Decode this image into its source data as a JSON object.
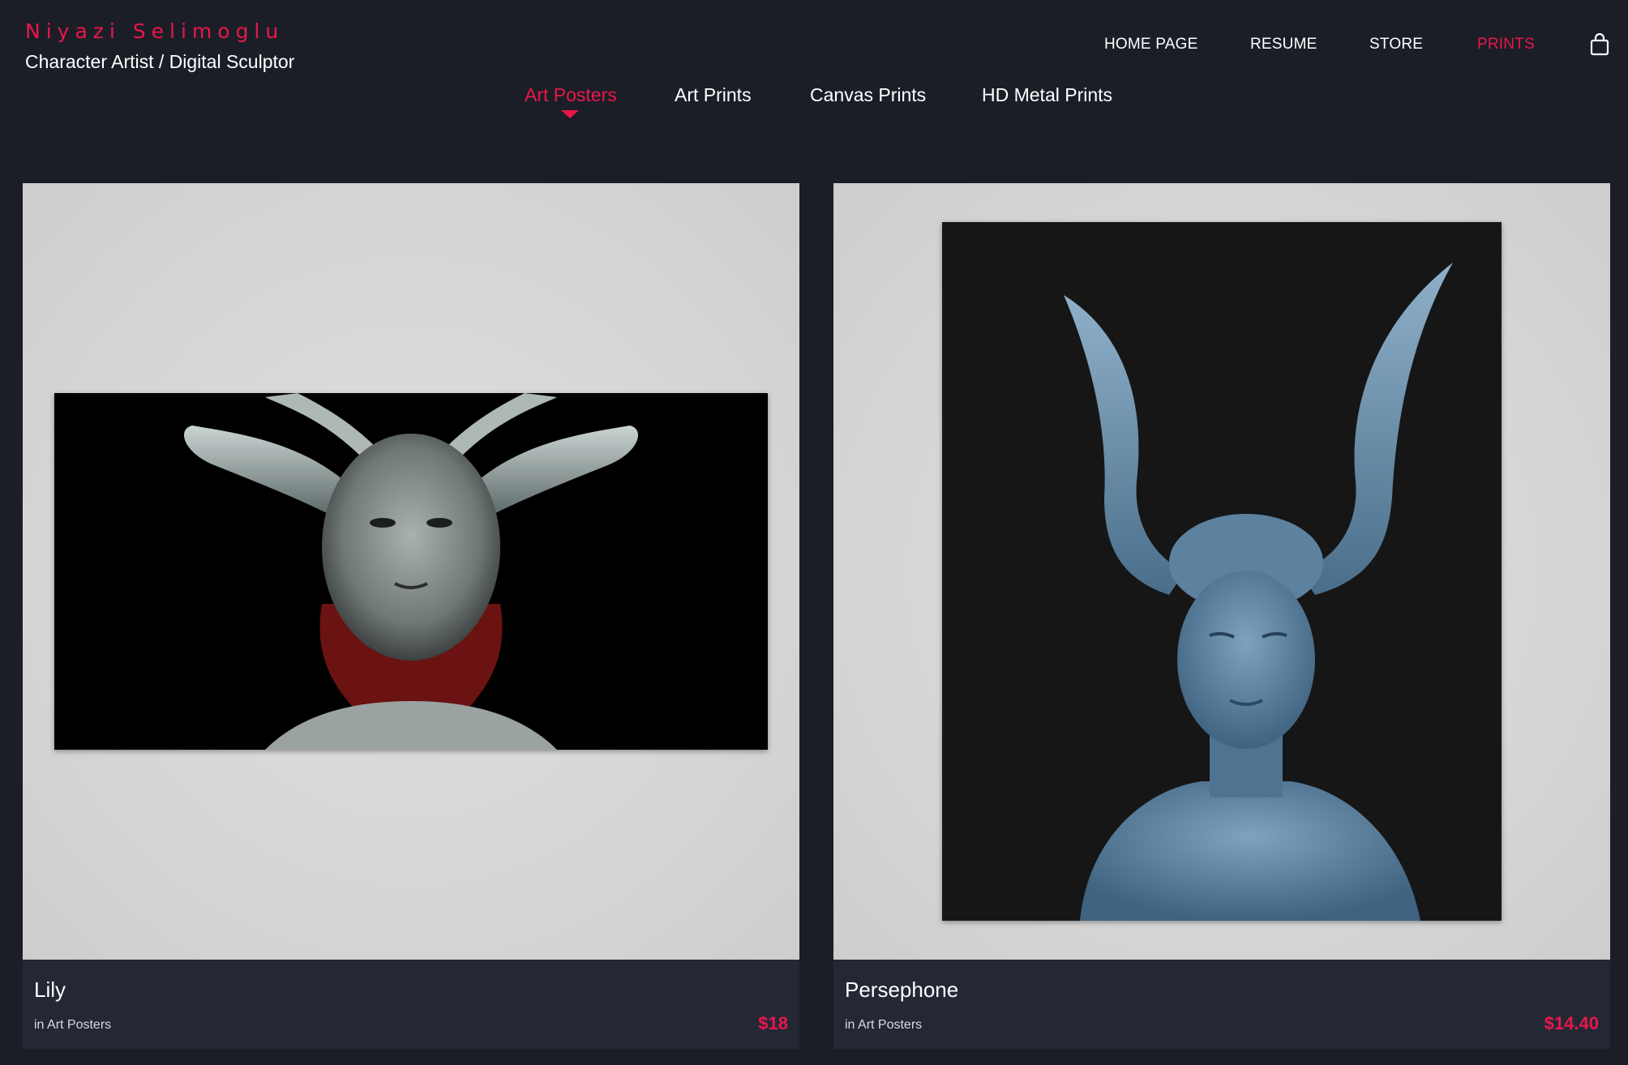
{
  "brand": {
    "name": "Niyazi Selimoglu",
    "tagline": "Character Artist / Digital Sculptor"
  },
  "nav": {
    "home": "HOME PAGE",
    "resume": "RESUME",
    "store": "STORE",
    "prints": "PRINTS",
    "cart_icon": "shopping-bag-icon"
  },
  "subnav": {
    "posters": "Art Posters",
    "art_prints": "Art Prints",
    "canvas": "Canvas Prints",
    "metal": "HD Metal Prints"
  },
  "products": [
    {
      "title": "Lily",
      "category": "in Art Posters",
      "price": "$18"
    },
    {
      "title": "Persephone",
      "category": "in Art Posters",
      "price": "$14.40"
    }
  ],
  "colors": {
    "accent": "#e8174b",
    "background": "#1b1e27",
    "card_footer": "#242835"
  }
}
